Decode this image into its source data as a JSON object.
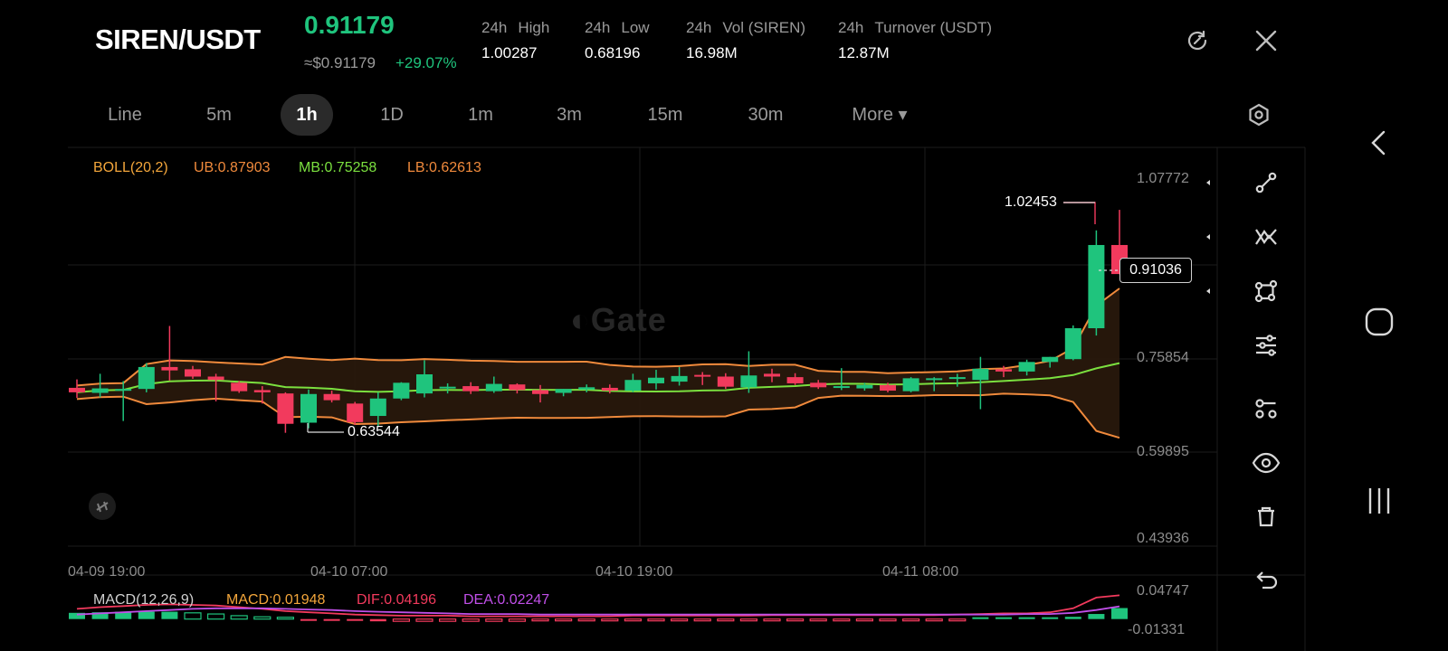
{
  "header": {
    "pair": "SIREN/USDT",
    "price": "0.91179",
    "approx": "≈$0.91179",
    "change": "+29.07%",
    "stats": [
      {
        "label_a": "24h",
        "label_b": "High",
        "value": "1.00287"
      },
      {
        "label_a": "24h",
        "label_b": "Low",
        "value": "0.68196"
      },
      {
        "label_a": "24h",
        "label_b": "Vol (SIREN)",
        "value": "16.98M"
      },
      {
        "label_a": "24h",
        "label_b": "Turnover (USDT)",
        "value": "12.87M"
      }
    ],
    "icons": [
      "refresh-icon",
      "close-icon"
    ]
  },
  "tabs": [
    "Line",
    "5m",
    "1h",
    "1D",
    "1m",
    "3m",
    "15m",
    "30m",
    "More ▾"
  ],
  "active_tab": "1h",
  "indicators": {
    "boll": {
      "name": "BOLL(20,2)",
      "ub": "UB:0.87903",
      "mb": "MB:0.75258",
      "lb": "LB:0.62613"
    },
    "macd": {
      "name": "MACD(12,26,9)",
      "macd": "MACD:0.01948",
      "dif": "DIF:0.04196",
      "dea": "DEA:0.02247"
    }
  },
  "colors": {
    "up": "#1fc47d",
    "down": "#f23a5d",
    "boll_bands": "#f08a3c",
    "boll_mid": "#7be03f",
    "macd_label": "#f3a63b",
    "dif": "#f23a5d",
    "dea": "#c04fe8",
    "boll_name": "#f3a63b"
  },
  "chart_data": {
    "type": "candlestick",
    "pair": "SIREN/USDT",
    "interval": "1h",
    "price_axis": [
      "1.07772",
      "0.75854",
      "0.59895",
      "0.43936"
    ],
    "time_axis": [
      "04-09 19:00",
      "04-10 07:00",
      "04-10 19:00",
      "04-11 08:00"
    ],
    "ylim": [
      0.43936,
      1.07772
    ],
    "high_marker": "1.02453",
    "low_marker": "0.63544",
    "last_price": "0.91036",
    "candles": [
      {
        "o": 0.708,
        "h": 0.723,
        "l": 0.69,
        "c": 0.7
      },
      {
        "o": 0.699,
        "h": 0.733,
        "l": 0.691,
        "c": 0.707
      },
      {
        "o": 0.706,
        "h": 0.72,
        "l": 0.649,
        "c": 0.706
      },
      {
        "o": 0.706,
        "h": 0.752,
        "l": 0.7,
        "c": 0.745
      },
      {
        "o": 0.745,
        "h": 0.818,
        "l": 0.721,
        "c": 0.739
      },
      {
        "o": 0.741,
        "h": 0.747,
        "l": 0.724,
        "c": 0.728
      },
      {
        "o": 0.728,
        "h": 0.733,
        "l": 0.684,
        "c": 0.722
      },
      {
        "o": 0.717,
        "h": 0.72,
        "l": 0.699,
        "c": 0.702
      },
      {
        "o": 0.704,
        "h": 0.711,
        "l": 0.68,
        "c": 0.7
      },
      {
        "o": 0.698,
        "h": 0.7,
        "l": 0.628,
        "c": 0.644
      },
      {
        "o": 0.646,
        "h": 0.705,
        "l": 0.636,
        "c": 0.697
      },
      {
        "o": 0.697,
        "h": 0.703,
        "l": 0.682,
        "c": 0.686
      },
      {
        "o": 0.68,
        "h": 0.683,
        "l": 0.642,
        "c": 0.647
      },
      {
        "o": 0.658,
        "h": 0.7,
        "l": 0.64,
        "c": 0.689
      },
      {
        "o": 0.689,
        "h": 0.718,
        "l": 0.686,
        "c": 0.717
      },
      {
        "o": 0.698,
        "h": 0.757,
        "l": 0.691,
        "c": 0.732
      },
      {
        "o": 0.71,
        "h": 0.716,
        "l": 0.698,
        "c": 0.71
      },
      {
        "o": 0.711,
        "h": 0.718,
        "l": 0.697,
        "c": 0.702
      },
      {
        "o": 0.702,
        "h": 0.728,
        "l": 0.699,
        "c": 0.715
      },
      {
        "o": 0.714,
        "h": 0.716,
        "l": 0.698,
        "c": 0.704
      },
      {
        "o": 0.704,
        "h": 0.713,
        "l": 0.682,
        "c": 0.697
      },
      {
        "o": 0.699,
        "h": 0.706,
        "l": 0.693,
        "c": 0.706
      },
      {
        "o": 0.705,
        "h": 0.714,
        "l": 0.7,
        "c": 0.709
      },
      {
        "o": 0.708,
        "h": 0.714,
        "l": 0.698,
        "c": 0.703
      },
      {
        "o": 0.703,
        "h": 0.733,
        "l": 0.7,
        "c": 0.722
      },
      {
        "o": 0.716,
        "h": 0.74,
        "l": 0.705,
        "c": 0.726
      },
      {
        "o": 0.719,
        "h": 0.745,
        "l": 0.712,
        "c": 0.729
      },
      {
        "o": 0.731,
        "h": 0.736,
        "l": 0.713,
        "c": 0.73
      },
      {
        "o": 0.728,
        "h": 0.734,
        "l": 0.706,
        "c": 0.71
      },
      {
        "o": 0.709,
        "h": 0.773,
        "l": 0.699,
        "c": 0.73
      },
      {
        "o": 0.733,
        "h": 0.742,
        "l": 0.718,
        "c": 0.728
      },
      {
        "o": 0.727,
        "h": 0.734,
        "l": 0.713,
        "c": 0.716
      },
      {
        "o": 0.717,
        "h": 0.722,
        "l": 0.706,
        "c": 0.709
      },
      {
        "o": 0.708,
        "h": 0.743,
        "l": 0.704,
        "c": 0.711
      },
      {
        "o": 0.707,
        "h": 0.717,
        "l": 0.703,
        "c": 0.713
      },
      {
        "o": 0.713,
        "h": 0.717,
        "l": 0.7,
        "c": 0.703
      },
      {
        "o": 0.702,
        "h": 0.727,
        "l": 0.7,
        "c": 0.725
      },
      {
        "o": 0.725,
        "h": 0.727,
        "l": 0.702,
        "c": 0.725
      },
      {
        "o": 0.726,
        "h": 0.733,
        "l": 0.71,
        "c": 0.727
      },
      {
        "o": 0.722,
        "h": 0.763,
        "l": 0.67,
        "c": 0.742
      },
      {
        "o": 0.741,
        "h": 0.747,
        "l": 0.727,
        "c": 0.737
      },
      {
        "o": 0.737,
        "h": 0.758,
        "l": 0.73,
        "c": 0.754
      },
      {
        "o": 0.754,
        "h": 0.763,
        "l": 0.744,
        "c": 0.763
      },
      {
        "o": 0.759,
        "h": 0.819,
        "l": 0.757,
        "c": 0.814
      },
      {
        "o": 0.814,
        "h": 0.988,
        "l": 0.801,
        "c": 0.962
      },
      {
        "o": 0.962,
        "h": 1.02453,
        "l": 0.91,
        "c": 0.91036
      }
    ],
    "macd_axis": [
      "0.04747",
      "-0.01331"
    ],
    "macd_hist": [
      0.011,
      0.012,
      0.013,
      0.013,
      0.013,
      0.011,
      0.009,
      0.006,
      0.004,
      0.001,
      -0.001,
      -0.002,
      -0.003,
      -0.004,
      -0.004,
      -0.004,
      -0.004,
      -0.004,
      -0.004,
      -0.004,
      -0.003,
      -0.003,
      -0.003,
      -0.003,
      -0.002,
      -0.002,
      -0.002,
      -0.002,
      -0.002,
      -0.002,
      -0.002,
      -0.002,
      -0.002,
      -0.002,
      -0.002,
      -0.002,
      -0.001,
      -0.001,
      -0.001,
      0.0,
      0.001,
      0.001,
      0.002,
      0.004,
      0.009,
      0.0195
    ],
    "dif": [
      0.018,
      0.021,
      0.023,
      0.025,
      0.026,
      0.025,
      0.024,
      0.021,
      0.018,
      0.014,
      0.012,
      0.01,
      0.008,
      0.007,
      0.006,
      0.006,
      0.006,
      0.005,
      0.005,
      0.005,
      0.005,
      0.005,
      0.005,
      0.005,
      0.006,
      0.006,
      0.006,
      0.006,
      0.006,
      0.006,
      0.007,
      0.007,
      0.007,
      0.007,
      0.007,
      0.007,
      0.007,
      0.007,
      0.008,
      0.009,
      0.01,
      0.01,
      0.012,
      0.019,
      0.038,
      0.042
    ],
    "dea": [
      0.008,
      0.01,
      0.012,
      0.014,
      0.016,
      0.018,
      0.019,
      0.019,
      0.019,
      0.018,
      0.017,
      0.016,
      0.014,
      0.013,
      0.012,
      0.011,
      0.01,
      0.009,
      0.009,
      0.009,
      0.008,
      0.008,
      0.008,
      0.008,
      0.008,
      0.008,
      0.008,
      0.008,
      0.008,
      0.008,
      0.008,
      0.008,
      0.008,
      0.008,
      0.008,
      0.008,
      0.008,
      0.008,
      0.008,
      0.008,
      0.008,
      0.009,
      0.009,
      0.011,
      0.016,
      0.0225
    ]
  },
  "toolbar": [
    "trend-line-icon",
    "multi-line-icon",
    "shape-icon",
    "sliders-icon",
    "indicator-icon",
    "eye-icon",
    "trash-icon",
    "undo-icon"
  ],
  "system_nav": [
    "back-icon",
    "home-icon",
    "recents-icon"
  ]
}
